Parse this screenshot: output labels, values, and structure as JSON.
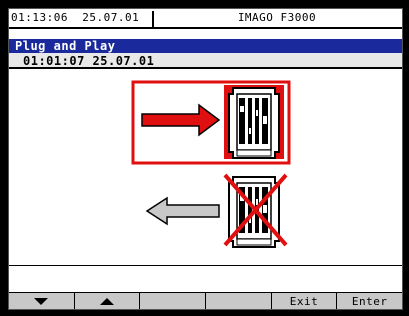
{
  "status_bar": {
    "time": "01:13:06",
    "date": "25.07.01",
    "device": "IMAGO F3000"
  },
  "dialog": {
    "title": "Plug and Play",
    "subtitle": "01:01:07 25.07.01"
  },
  "softkeys": [
    {
      "label": "",
      "icon": "triangle-down-icon"
    },
    {
      "label": "",
      "icon": "triangle-up-icon"
    },
    {
      "label": ""
    },
    {
      "label": ""
    },
    {
      "label": "Exit"
    },
    {
      "label": "Enter"
    }
  ],
  "colors": {
    "accent_red": "#e01010",
    "title_blue": "#1a2a9c",
    "arrow_gray": "#c8c8c8"
  }
}
